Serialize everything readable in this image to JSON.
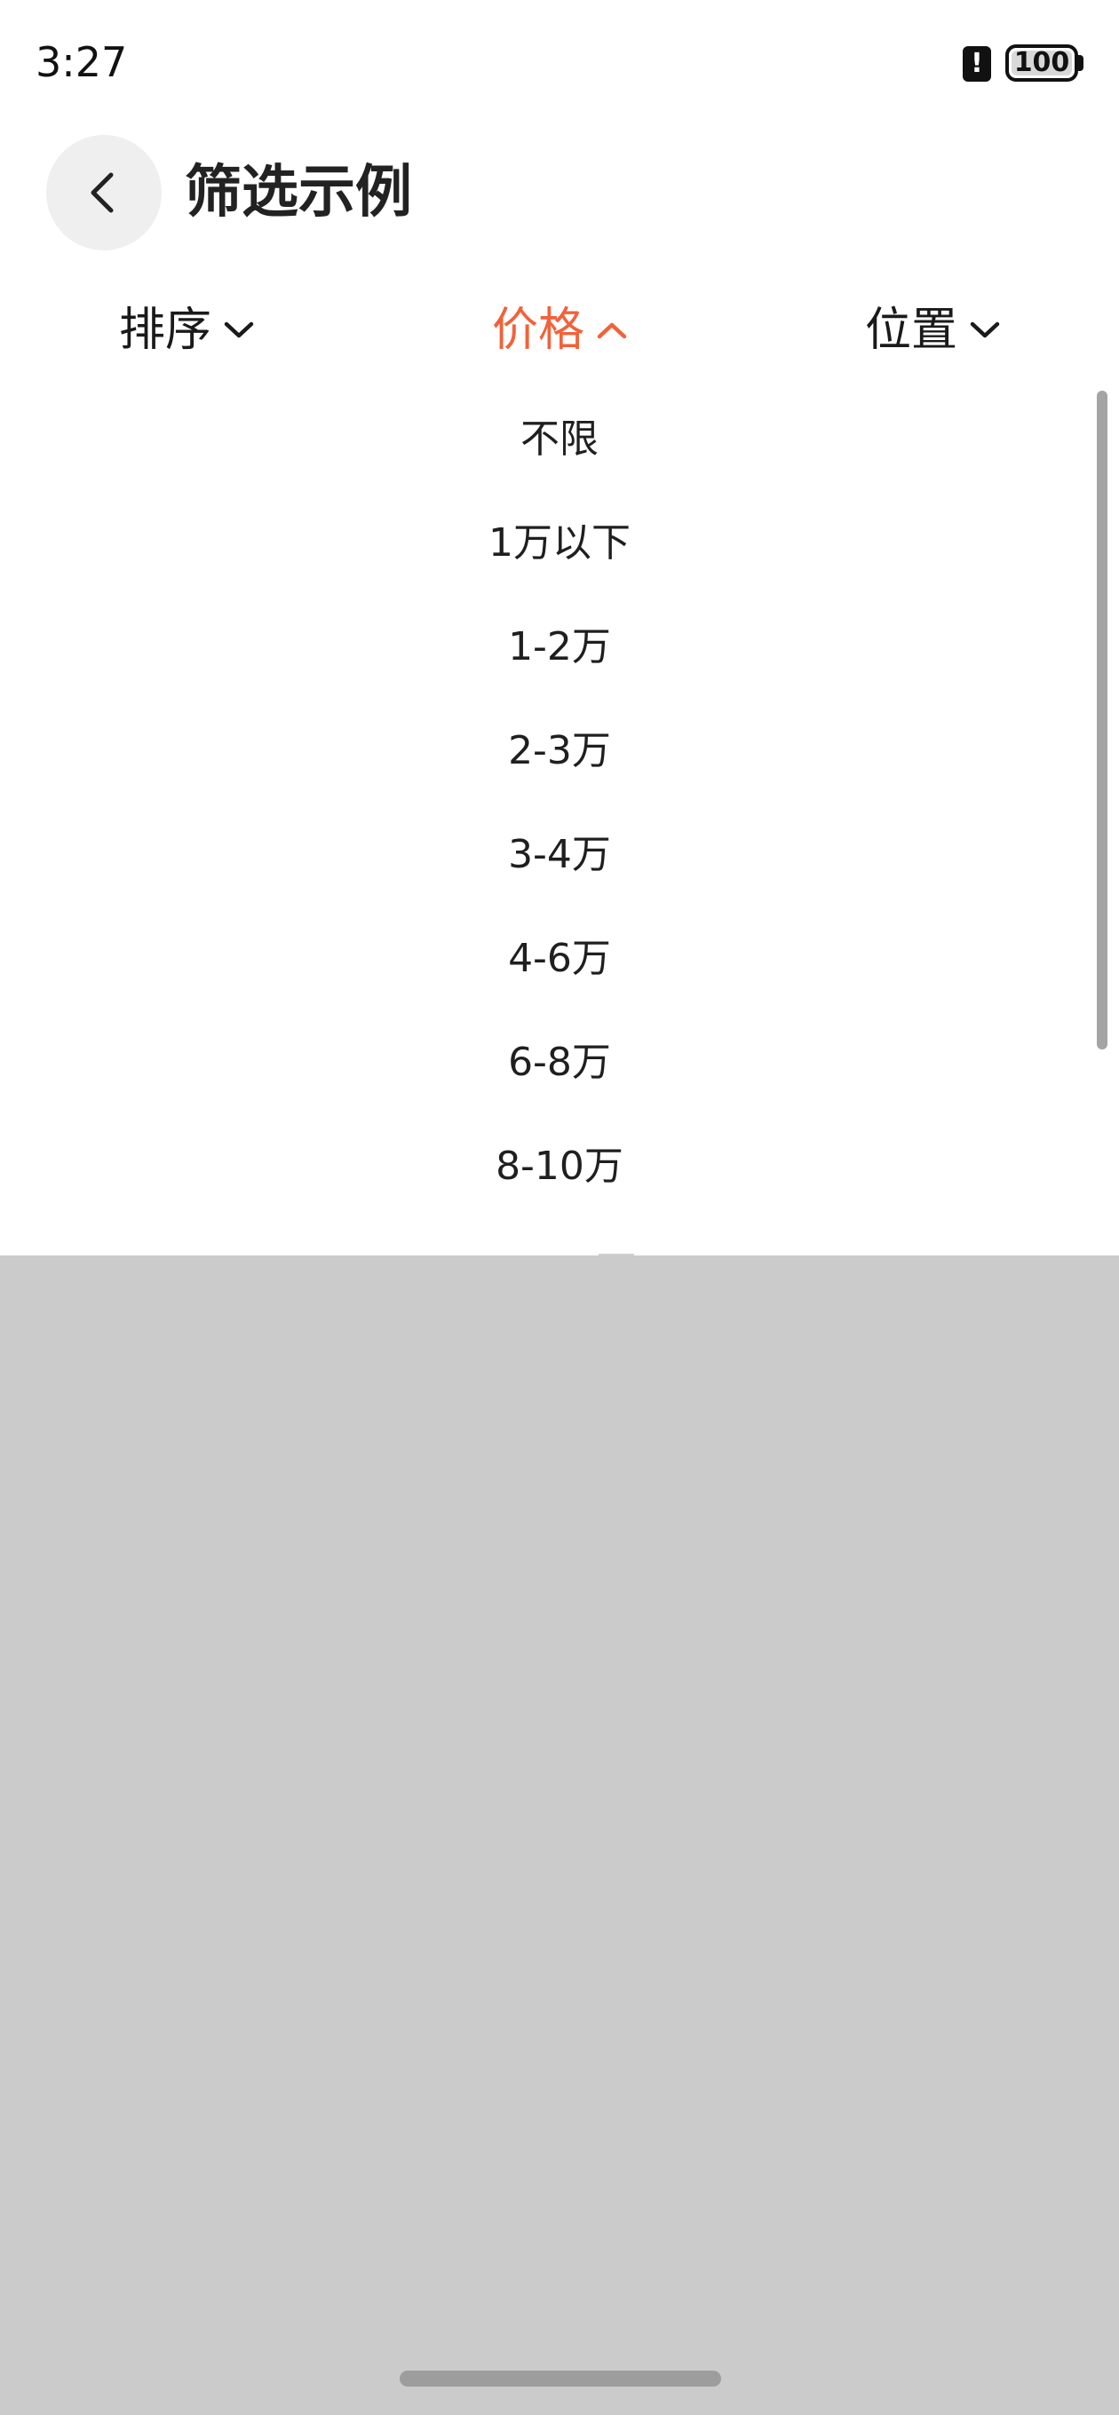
{
  "status_bar": {
    "time": "3:27",
    "alert_icon": "notification-alert-icon",
    "battery_icon": "battery-icon",
    "battery_level": 100,
    "battery_text": "100"
  },
  "header": {
    "back_icon": "chevron-left-icon",
    "title": "筛选示例"
  },
  "filters": {
    "tabs": [
      {
        "label": "排序",
        "icon": "chevron-down-icon",
        "state": "collapsed"
      },
      {
        "label": "价格",
        "icon": "chevron-up-icon",
        "state": "expanded"
      },
      {
        "label": "位置",
        "icon": "chevron-down-icon",
        "state": "collapsed"
      }
    ],
    "active_color": "#F2623A",
    "inactive_color": "#1A1A1A"
  },
  "dropdown": {
    "options": [
      "不限",
      "1万以下",
      "1-2万",
      "2-3万",
      "3-4万",
      "4-6万",
      "6-8万",
      "8-10万"
    ]
  },
  "colors": {
    "overlay": "#CBCBCB",
    "back_button_bg": "#EFEFEF"
  }
}
